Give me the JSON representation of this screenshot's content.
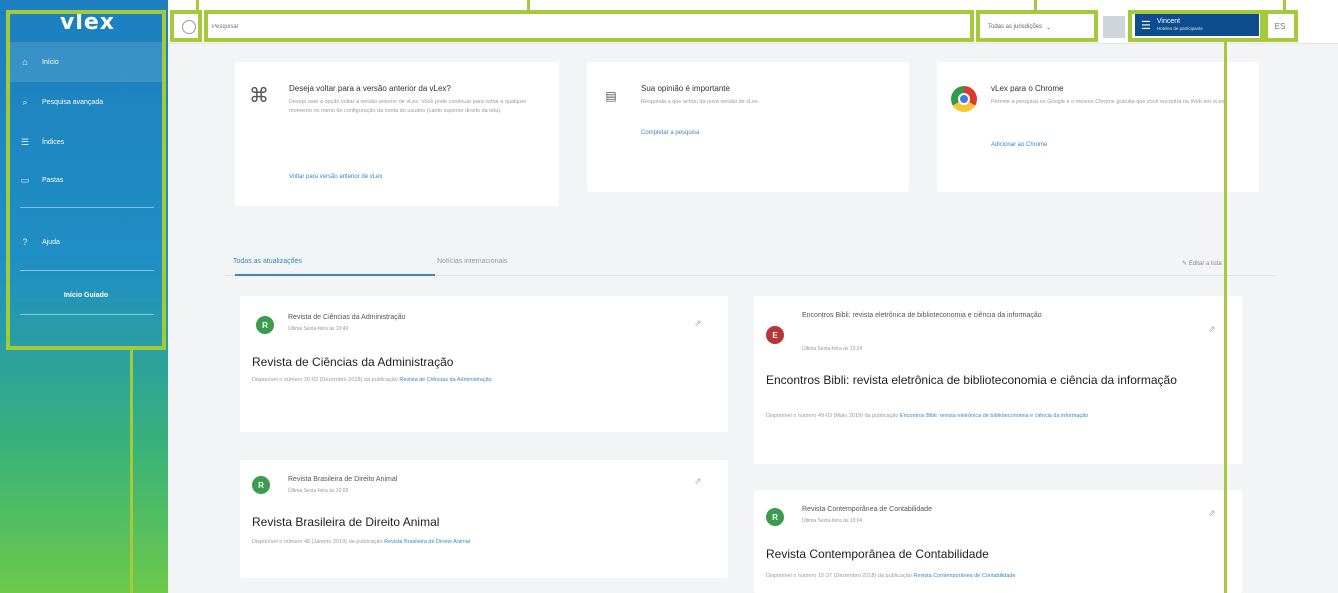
{
  "logo": "vlex",
  "sidebar": {
    "items": [
      {
        "label": "Início",
        "icon": "home-icon"
      },
      {
        "label": "Pesquisa avançada",
        "icon": "search-icon"
      },
      {
        "label": "Índices",
        "icon": "index-icon"
      },
      {
        "label": "Pastas",
        "icon": "folder-icon"
      },
      {
        "label": "Ajuda",
        "icon": "help-icon"
      }
    ],
    "guided_tour": "Início Guiado"
  },
  "topbar": {
    "search_placeholder": "Pesquisar",
    "filter_label": "Todas as jurisdições",
    "user_name": "Vincent",
    "user_sub": "Hoteles de participante",
    "lang_label": "ES"
  },
  "promos": [
    {
      "title": "Deseja voltar para a versão anterior da vLex?",
      "desc": "Deseja usar a opção voltar à versão anterior de vLex. Você pode continuar para voltar a qualquer momento no menu de configuração da conta do usuário (canto superior direito da tela).",
      "link": "Voltar para versão anterior de vLex",
      "icon": "fingerprint-icon"
    },
    {
      "title": "Sua opinião é importante",
      "desc": "Responda a que achou da nova versão de vLex.",
      "link": "Completar a pesquisa",
      "icon": "survey-icon"
    },
    {
      "title": "vLex para o Chrome",
      "desc": "Permite a pesquisa no Google e o mesmo Chrome gratuita que você encontra na Web em vLex.",
      "link": "Adicionar ao Chrome",
      "icon": "chrome-icon"
    }
  ],
  "tabs": [
    "Todas as atualizações",
    "Notícias internacionais"
  ],
  "edit_link": "Editar a lista",
  "cards": [
    {
      "letter": "R",
      "color": "#3d9b4e",
      "source": "Revista de Ciências da Administração",
      "time": "Última Sexta-feira às 10:49",
      "title": "Revista de Ciências da Administração",
      "desc": "Disponível o número 20-02 (Dezembro 2018) da publicação ",
      "desc_link": "Revista de Ciências da Administração"
    },
    {
      "letter": "E",
      "color": "#b6363a",
      "source": "Encontros Bibli: revista eletrônica de biblioteconomia e ciência da informação",
      "time": "Última Sexta-feira às 13:24",
      "title": "Encontros Bibli: revista eletrônica de biblioteconomia e ciência da informação",
      "desc": "Disponível o número 49-03 (Maio 2019) da publicação ",
      "desc_link": "Encontros Bibli: revista eletrônica de biblioteconomia e ciência da informação"
    },
    {
      "letter": "R",
      "color": "#3d9b4e",
      "source": "Revista Brasileira de Direito Animal",
      "time": "Última Sexta-feira às 10:09",
      "title": "Revista Brasileira de Direito Animal",
      "desc": "Disponível o número 48 (Janeiro 2019) da publicação ",
      "desc_link": "Revista Brasileira de Direito Animal"
    },
    {
      "letter": "R",
      "color": "#3d9b4e",
      "source": "Revista Contemporânea de Contabilidade",
      "time": "Última Sexta-feira às 13:04",
      "title": "Revista Contemporânea de Contabilidade",
      "desc": "Disponível o número 15-37 (Dezembro 2018) da publicação ",
      "desc_link": "Revista Contemporânea de Contabilidade"
    }
  ]
}
